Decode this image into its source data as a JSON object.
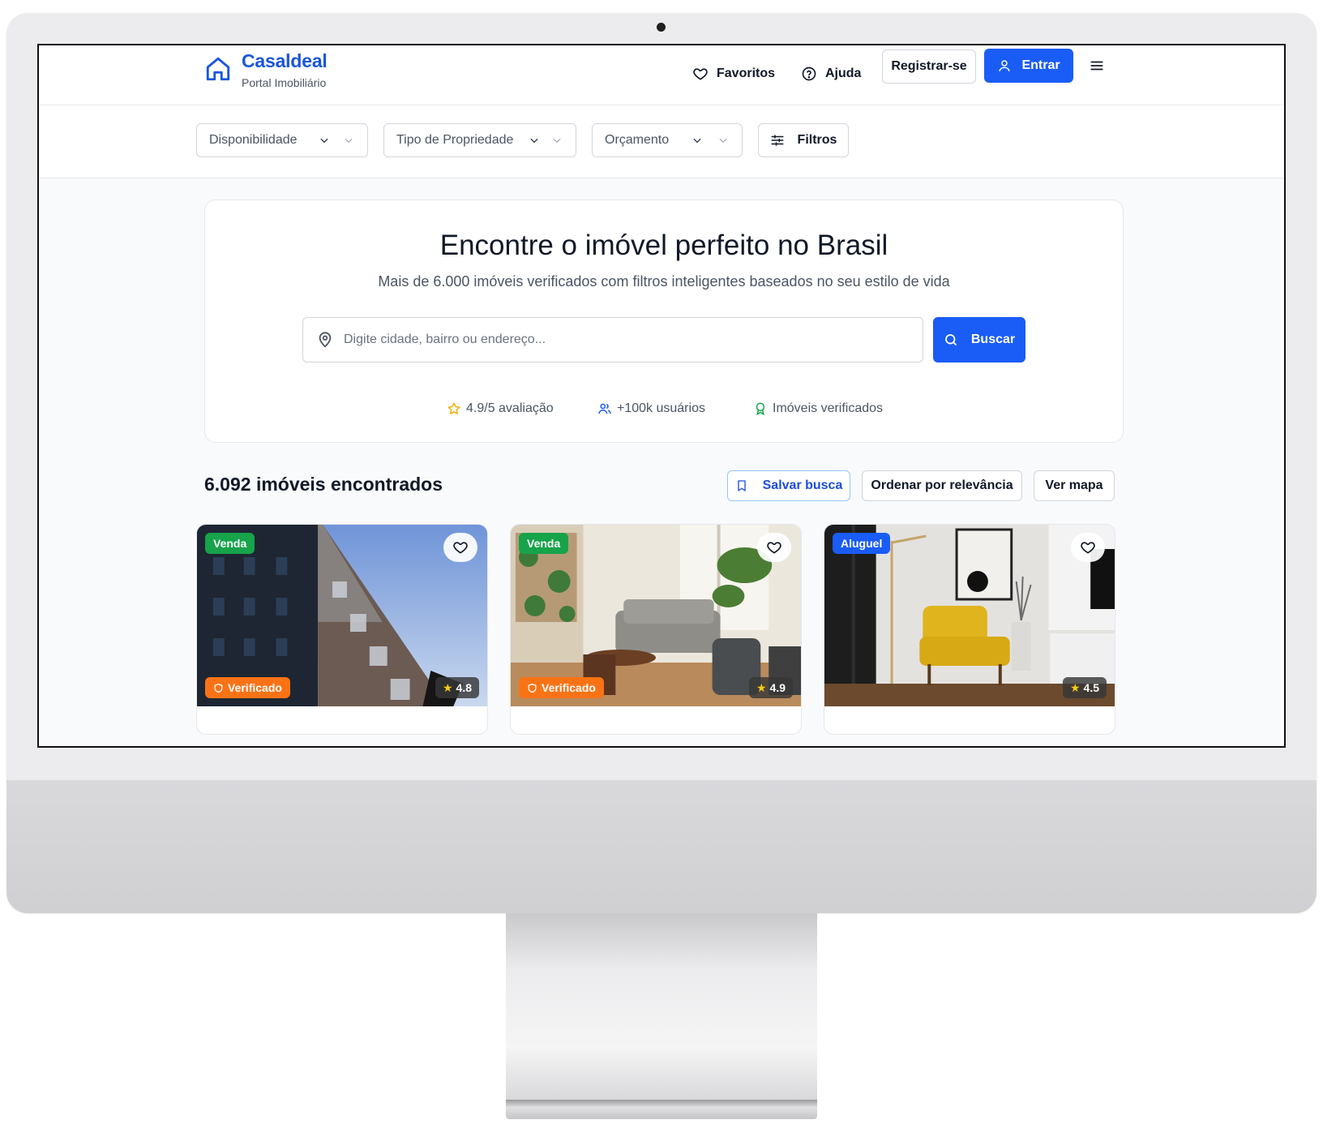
{
  "brand": {
    "name": "Casaldeal",
    "tagline": "Portal Imobiliário",
    "accent": "#1a5cf6"
  },
  "nav": {
    "favorites": "Favoritos",
    "help": "Ajuda",
    "register": "Registrar-se",
    "login": "Entrar",
    "menu_icon": "hamburger-icon"
  },
  "filters": {
    "availability": "Disponibilidade",
    "property_type": "Tipo de Propriedade",
    "budget": "Orçamento",
    "more": "Filtros"
  },
  "hero": {
    "title": "Encontre o imóvel perfeito no Brasil",
    "subtitle": "Mais de 6.000 imóveis verificados com filtros inteligentes baseados no seu estilo de vida",
    "search_placeholder": "Digite cidade, bairro ou endereço...",
    "search_button": "Buscar",
    "stats": {
      "rating": "4.9/5 avaliação",
      "users": "+100k usuários",
      "verified": "Imóveis verificados"
    }
  },
  "results": {
    "count_label": "6.092 imóveis encontrados",
    "save_search": "Salvar busca",
    "sort": "Ordenar por relevância",
    "map": "Ver mapa"
  },
  "listings": [
    {
      "type": "Venda",
      "verified": "Verificado",
      "rating": "4.8",
      "image": "apartment-building-photo"
    },
    {
      "type": "Venda",
      "verified": "Verificado",
      "rating": "4.9",
      "image": "living-room-plants-photo"
    },
    {
      "type": "Aluguel",
      "verified": "",
      "rating": "4.5",
      "image": "yellow-armchair-room-photo"
    }
  ]
}
